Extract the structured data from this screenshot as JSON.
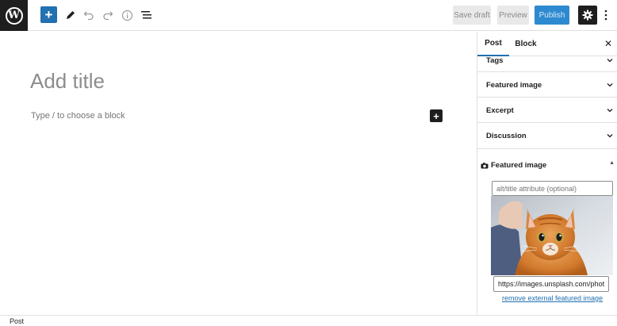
{
  "toolbar": {
    "logo_letter": "W",
    "add_block_symbol": "+",
    "save_draft_label": "Save draft",
    "preview_label": "Preview",
    "publish_label": "Publish"
  },
  "editor": {
    "title_placeholder": "Add title",
    "block_placeholder": "Type / to choose a block",
    "inline_add_symbol": "+"
  },
  "sidebar": {
    "tabs": [
      {
        "label": "Post",
        "active": true
      },
      {
        "label": "Block",
        "active": false
      }
    ],
    "close_symbol": "✕",
    "panels": [
      {
        "label": "Tags"
      },
      {
        "label": "Featured image"
      },
      {
        "label": "Excerpt"
      },
      {
        "label": "Discussion"
      }
    ],
    "external_featured": {
      "title": "Featured image",
      "camera_symbol": "📷",
      "caret_symbol": "▲",
      "alt_placeholder": "alt/title attribute (optional)",
      "url_value": "https://images.unsplash.com/photo",
      "remove_link": "remove external featured image"
    }
  },
  "footer": {
    "breadcrumb": "Post"
  },
  "colors": {
    "accent": "#2271b1",
    "publish_bg": "#2e8ad0",
    "dark": "#1e1e1e"
  },
  "icons": [
    "wordpress-logo-icon",
    "plus-icon",
    "pencil-icon",
    "undo-icon",
    "redo-icon",
    "info-icon",
    "list-view-icon",
    "gear-icon",
    "more-vertical-icon",
    "close-icon",
    "chevron-down-icon",
    "camera-icon",
    "caret-up-icon"
  ]
}
